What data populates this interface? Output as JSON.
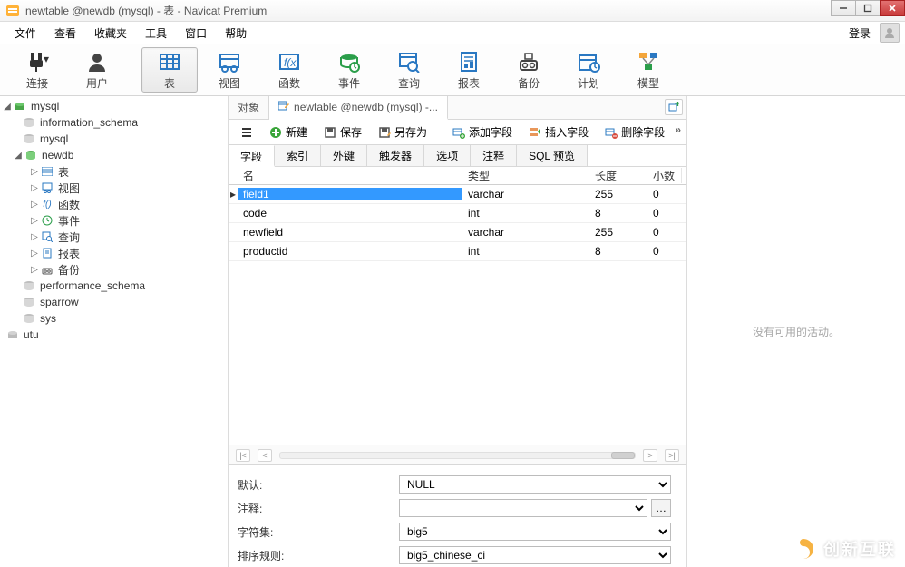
{
  "window": {
    "title": "newtable @newdb (mysql) - 表 - Navicat Premium"
  },
  "menubar": {
    "items": [
      "文件",
      "查看",
      "收藏夹",
      "工具",
      "窗口",
      "帮助"
    ],
    "login": "登录"
  },
  "toolbar": {
    "items": [
      {
        "key": "connect",
        "label": "连接"
      },
      {
        "key": "user",
        "label": "用户"
      },
      {
        "key": "table",
        "label": "表",
        "active": true
      },
      {
        "key": "view",
        "label": "视图"
      },
      {
        "key": "function",
        "label": "函数"
      },
      {
        "key": "event",
        "label": "事件"
      },
      {
        "key": "query",
        "label": "查询"
      },
      {
        "key": "report",
        "label": "报表"
      },
      {
        "key": "backup",
        "label": "备份"
      },
      {
        "key": "schedule",
        "label": "计划"
      },
      {
        "key": "model",
        "label": "模型"
      }
    ]
  },
  "tree": {
    "mysql": "mysql",
    "information_schema": "information_schema",
    "mysql_db": "mysql",
    "newdb": "newdb",
    "newdb_children": [
      "表",
      "视图",
      "函数",
      "事件",
      "查询",
      "报表",
      "备份"
    ],
    "performance_schema": "performance_schema",
    "sparrow": "sparrow",
    "sys": "sys",
    "utu": "utu"
  },
  "tabs": {
    "obj": "对象",
    "current": "newtable @newdb (mysql) -..."
  },
  "designerbar": {
    "new": "新建",
    "save": "保存",
    "saveas": "另存为",
    "addfield": "添加字段",
    "insertfield": "插入字段",
    "deletefield": "删除字段"
  },
  "subtabs": [
    "字段",
    "索引",
    "外键",
    "触发器",
    "选项",
    "注释",
    "SQL 预览"
  ],
  "grid": {
    "headers": {
      "name": "名",
      "type": "类型",
      "len": "长度",
      "dec": "小数"
    },
    "rows": [
      {
        "name": "field1",
        "type": "varchar",
        "len": "255",
        "dec": "0",
        "sel": true
      },
      {
        "name": "code",
        "type": "int",
        "len": "8",
        "dec": "0"
      },
      {
        "name": "newfield",
        "type": "varchar",
        "len": "255",
        "dec": "0"
      },
      {
        "name": "productid",
        "type": "int",
        "len": "8",
        "dec": "0"
      }
    ]
  },
  "props": {
    "default_label": "默认:",
    "default_value": "NULL",
    "comment_label": "注释:",
    "comment_value": "",
    "charset_label": "字符集:",
    "charset_value": "big5",
    "collation_label": "排序规则:",
    "collation_value": "big5_chinese_ci"
  },
  "rightpanel": {
    "empty": "没有可用的活动。"
  },
  "watermark": "创新互联"
}
